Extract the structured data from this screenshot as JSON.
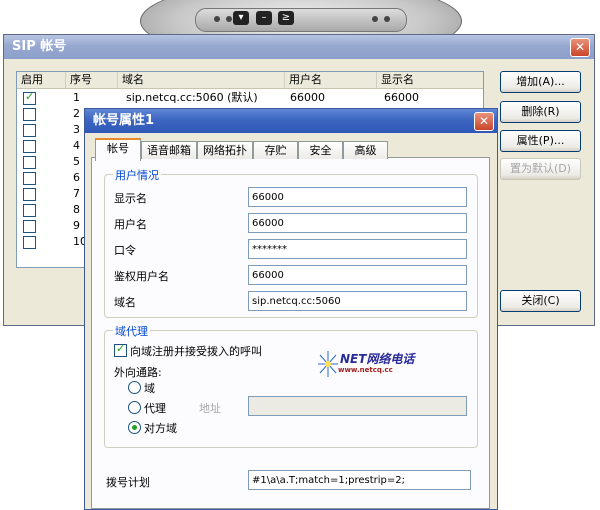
{
  "phone": {
    "buttons": [
      "▾",
      "–",
      "≥"
    ]
  },
  "main_window": {
    "title": "SIP 帐号",
    "columns": [
      "启用",
      "序号",
      "域名",
      "用户名",
      "显示名"
    ],
    "rows": [
      {
        "enabled": true,
        "index": "1",
        "domain": "sip.netcq.cc:5060 (默认)",
        "user": "66000",
        "display": "66000"
      },
      {
        "enabled": false,
        "index": "2",
        "domain": "",
        "user": "",
        "display": ""
      },
      {
        "enabled": false,
        "index": "3",
        "domain": "",
        "user": "",
        "display": ""
      },
      {
        "enabled": false,
        "index": "4",
        "domain": "",
        "user": "",
        "display": ""
      },
      {
        "enabled": false,
        "index": "5",
        "domain": "",
        "user": "",
        "display": ""
      },
      {
        "enabled": false,
        "index": "6",
        "domain": "",
        "user": "",
        "display": ""
      },
      {
        "enabled": false,
        "index": "7",
        "domain": "",
        "user": "",
        "display": ""
      },
      {
        "enabled": false,
        "index": "8",
        "domain": "",
        "user": "",
        "display": ""
      },
      {
        "enabled": false,
        "index": "9",
        "domain": "",
        "user": "",
        "display": ""
      },
      {
        "enabled": false,
        "index": "10",
        "domain": "",
        "user": "",
        "display": ""
      }
    ],
    "buttons": {
      "add": "增加(A)...",
      "delete": "删除(R)",
      "properties": "属性(P)...",
      "set_default": "置为默认(D)",
      "close": "关闭(C)"
    }
  },
  "dialog": {
    "title": "帐号属性1",
    "tabs": [
      "帐号",
      "语音邮箱",
      "网络拓扑",
      "存贮",
      "安全",
      "高级"
    ],
    "user_group": {
      "title": "用户情况",
      "fields": [
        {
          "label": "显示名",
          "value": "66000"
        },
        {
          "label": "用户名",
          "value": "66000"
        },
        {
          "label": "口令",
          "value": "*******"
        },
        {
          "label": "鉴权用户名",
          "value": "66000"
        },
        {
          "label": "域名",
          "value": "sip.netcq.cc:5060"
        }
      ]
    },
    "proxy_group": {
      "title": "域代理",
      "register_checkbox": "向域注册并接受拨入的呼叫",
      "outbound_label": "外向通路:",
      "radio_domain": "域",
      "radio_proxy": "代理",
      "address_label": "地址",
      "address_value": "",
      "radio_peer": "对方域"
    },
    "dial_plan_label": "拨号计划",
    "dial_plan_value": "#1\\a\\a.T;match=1;prestrip=2;"
  },
  "logo": {
    "text": "NET网络电话",
    "sub": "www.netcq.cc"
  },
  "colors": {
    "title_active": "#7a8fc0",
    "close_red": "#c9452a",
    "link_blue": "#0046d5",
    "check_green": "#21a121"
  }
}
